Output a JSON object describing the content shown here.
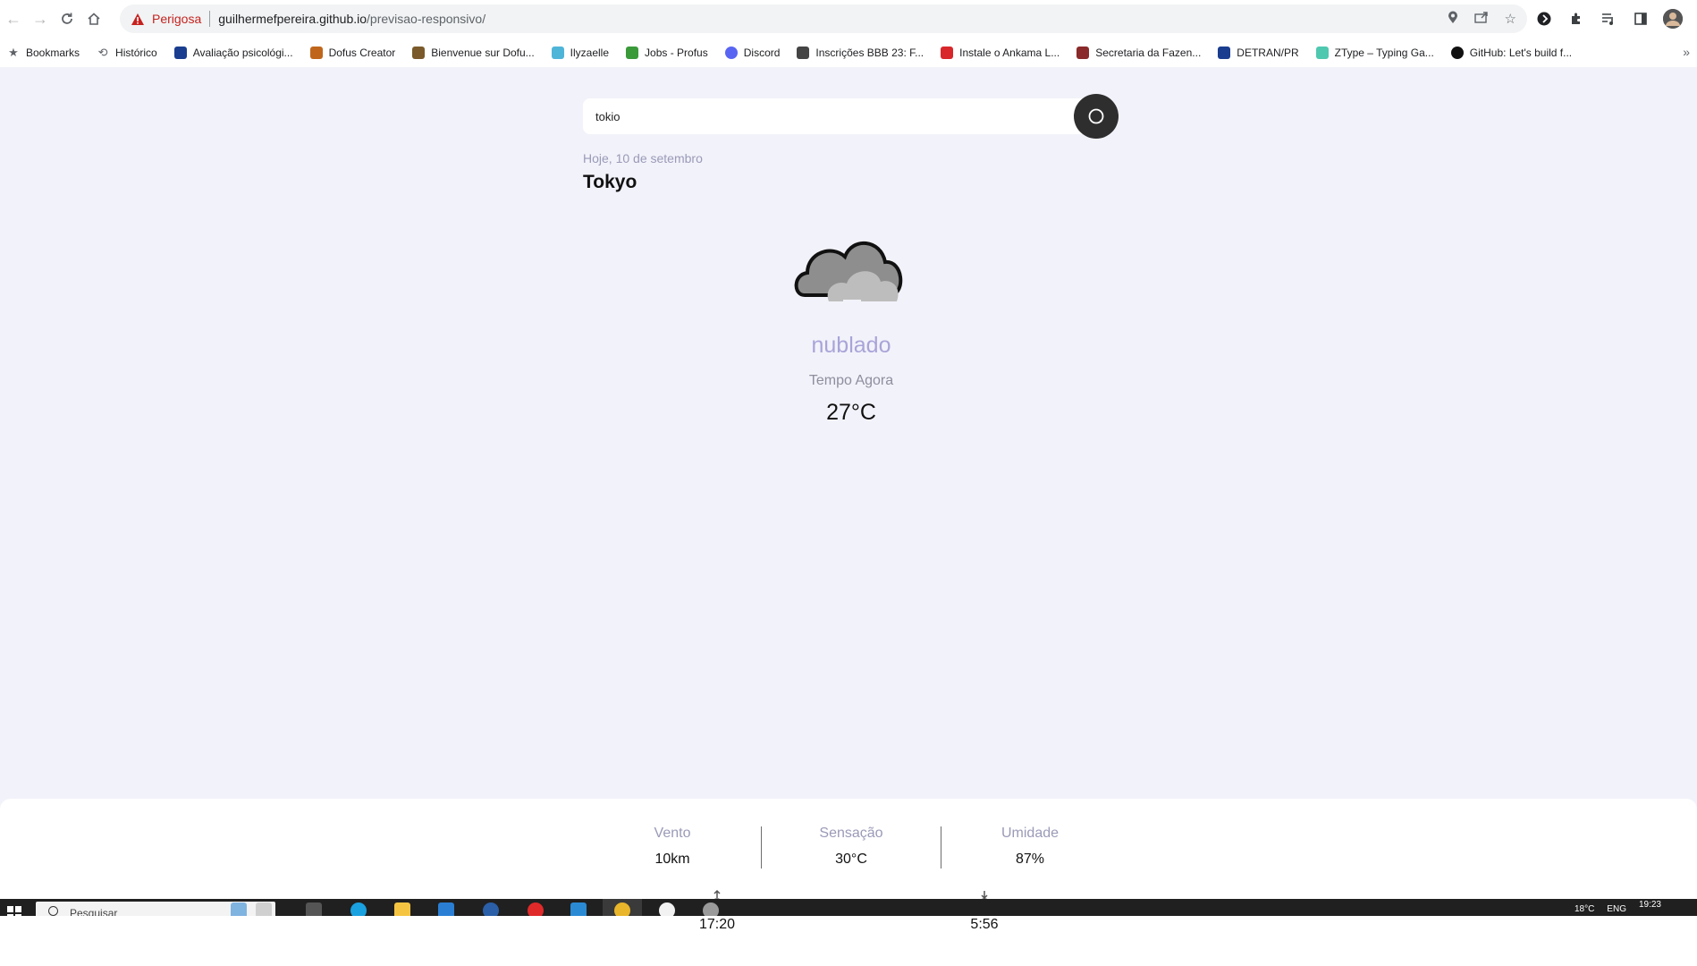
{
  "browser": {
    "security_status": "Perigosa",
    "url_host": "guilhermefpereira.github.io",
    "url_path": "/previsao-responsivo/",
    "bookmarks": [
      {
        "label": "Bookmarks",
        "icon": "star-icon",
        "color": "#5f6368"
      },
      {
        "label": "Histórico",
        "icon": "history-icon",
        "color": "#5f6368"
      },
      {
        "label": "Avaliação psicológi...",
        "icon": "site-icon",
        "color": "#1a3d8f"
      },
      {
        "label": "Dofus Creator",
        "icon": "site-icon",
        "color": "#c0661c"
      },
      {
        "label": "Bienvenue sur Dofu...",
        "icon": "site-icon",
        "color": "#7a5a2a"
      },
      {
        "label": "Ilyzaelle",
        "icon": "site-icon",
        "color": "#4fb5d8"
      },
      {
        "label": "Jobs - Profus",
        "icon": "site-icon",
        "color": "#3a9a3a"
      },
      {
        "label": "Discord",
        "icon": "discord-icon",
        "color": "#5865f2"
      },
      {
        "label": "Inscrições BBB 23: F...",
        "icon": "site-icon",
        "color": "#444444"
      },
      {
        "label": "Instale o Ankama L...",
        "icon": "site-icon",
        "color": "#d8262a"
      },
      {
        "label": "Secretaria da Fazen...",
        "icon": "site-icon",
        "color": "#8a2a2a"
      },
      {
        "label": "DETRAN/PR",
        "icon": "site-icon",
        "color": "#1a3d8f"
      },
      {
        "label": "ZType – Typing Ga...",
        "icon": "site-icon",
        "color": "#4fc8b0"
      },
      {
        "label": "GitHub: Let's build f...",
        "icon": "github-icon",
        "color": "#111111"
      }
    ]
  },
  "search": {
    "value": "tokio"
  },
  "weather": {
    "date": "Hoje, 10 de setembro",
    "city": "Tokyo",
    "icon": "cloud-icon",
    "description": "nublado",
    "now_label": "Tempo Agora",
    "temperature": "27°C"
  },
  "details": {
    "wind_label": "Vento",
    "wind_value": "10km",
    "feels_label": "Sensação",
    "feels_value": "30°C",
    "humidity_label": "Umidade",
    "humidity_value": "87%",
    "sunset_time": "17:20",
    "sunrise_time": "5:56"
  },
  "taskbar": {
    "search_text": "Pesquisar",
    "time": "19:23",
    "weather": "18°C",
    "lang": "ENG"
  },
  "colors": {
    "page_bg": "#f2f2fa",
    "accent_desc": "#a8a4d8",
    "search_button": "#2e2e2e",
    "danger": "#c5221f"
  }
}
